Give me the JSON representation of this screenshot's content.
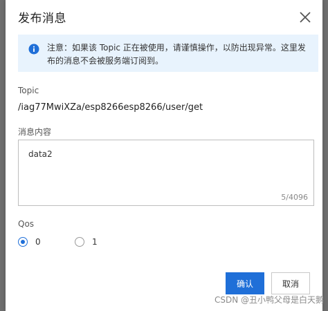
{
  "dialog": {
    "title": "发布消息",
    "notice_line1": "注意：如果该 Topic 正在被使用，请谨慎操作，以防出现异常。这里发",
    "notice_line2": "布的消息不会被服务端订阅到。",
    "topic_label": "Topic",
    "topic_value": "/iag77MwiXZa/esp8266esp8266/user/get",
    "content_label": "消息内容",
    "content_value": "data2",
    "content_counter": "5/4096",
    "qos_label": "Qos",
    "qos_options": [
      {
        "label": "0",
        "selected": true
      },
      {
        "label": "1",
        "selected": false
      }
    ],
    "confirm_label": "确认",
    "cancel_label": "取消"
  },
  "watermark": "CSDN @丑小鸭父母是白天鹅",
  "colors": {
    "accent": "#1f6fd8",
    "notice_bg": "#e8f3fd"
  },
  "icons": [
    "close-icon",
    "info-icon"
  ]
}
